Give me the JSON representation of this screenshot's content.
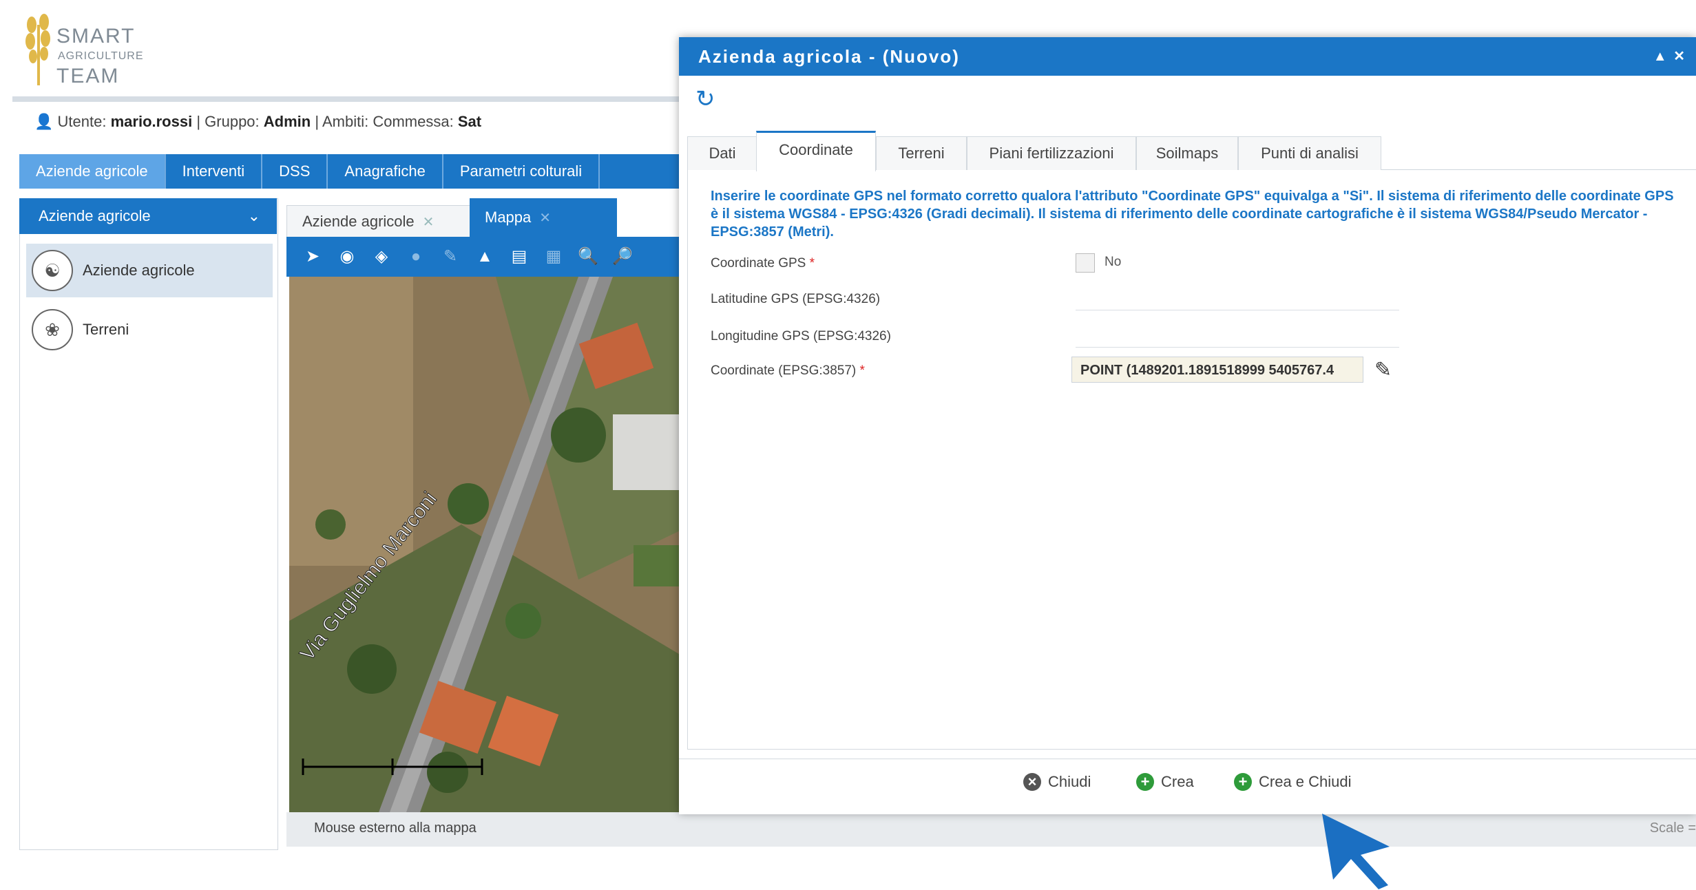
{
  "logo": {
    "line1": "SMART",
    "line2": "AGRICULTURE",
    "line3": "TEAM"
  },
  "userbar": {
    "user_prefix": "Utente:",
    "user": "mario.rossi",
    "group_prefix": "| Gruppo:",
    "group": "Admin",
    "scope_prefix": "| Ambiti: Commessa:",
    "scope": "Sat"
  },
  "mainnav": [
    "Aziende agricole",
    "Interventi",
    "DSS",
    "Anagrafiche",
    "Parametri colturali"
  ],
  "accordion": {
    "title": "Aziende agricole",
    "items": [
      "Aziende agricole",
      "Terreni"
    ]
  },
  "maptabs": {
    "tab1": "Aziende agricole",
    "tab2": "Mappa"
  },
  "map": {
    "street_label": "Via Guglielmo Marconi",
    "status": "Mouse esterno alla mappa",
    "scale": "Scale ="
  },
  "dialog": {
    "title": "Azienda agricola - (Nuovo)",
    "tabs": [
      "Dati",
      "Coordinate",
      "Terreni",
      "Piani fertilizzazioni",
      "Soilmaps",
      "Punti di analisi"
    ],
    "active_tab": "Coordinate",
    "info": "Inserire le coordinate GPS nel formato corretto qualora l'attributo \"Coordinate GPS\" equivalga a \"Si\". Il sistema di riferimento delle coordinate GPS è il sistema WGS84 - EPSG:4326 (Gradi decimali). Il sistema di riferimento delle coordinate cartografiche è il sistema WGS84/Pseudo Mercator - EPSG:3857 (Metri).",
    "fields": {
      "gps_label": "Coordinate GPS",
      "gps_value": "No",
      "lat_label": "Latitudine GPS (EPSG:4326)",
      "lon_label": "Longitudine GPS (EPSG:4326)",
      "coord_label": "Coordinate (EPSG:3857)",
      "coord_value": "POINT (1489201.1891518999 5405767.4"
    },
    "buttons": {
      "close": "Chiudi",
      "create": "Crea",
      "create_close": "Crea e Chiudi"
    }
  },
  "colors": {
    "primary": "#1b76c6",
    "nav_active": "#5ea5e6",
    "required": "#dd2222",
    "green": "#2e9b3a"
  }
}
